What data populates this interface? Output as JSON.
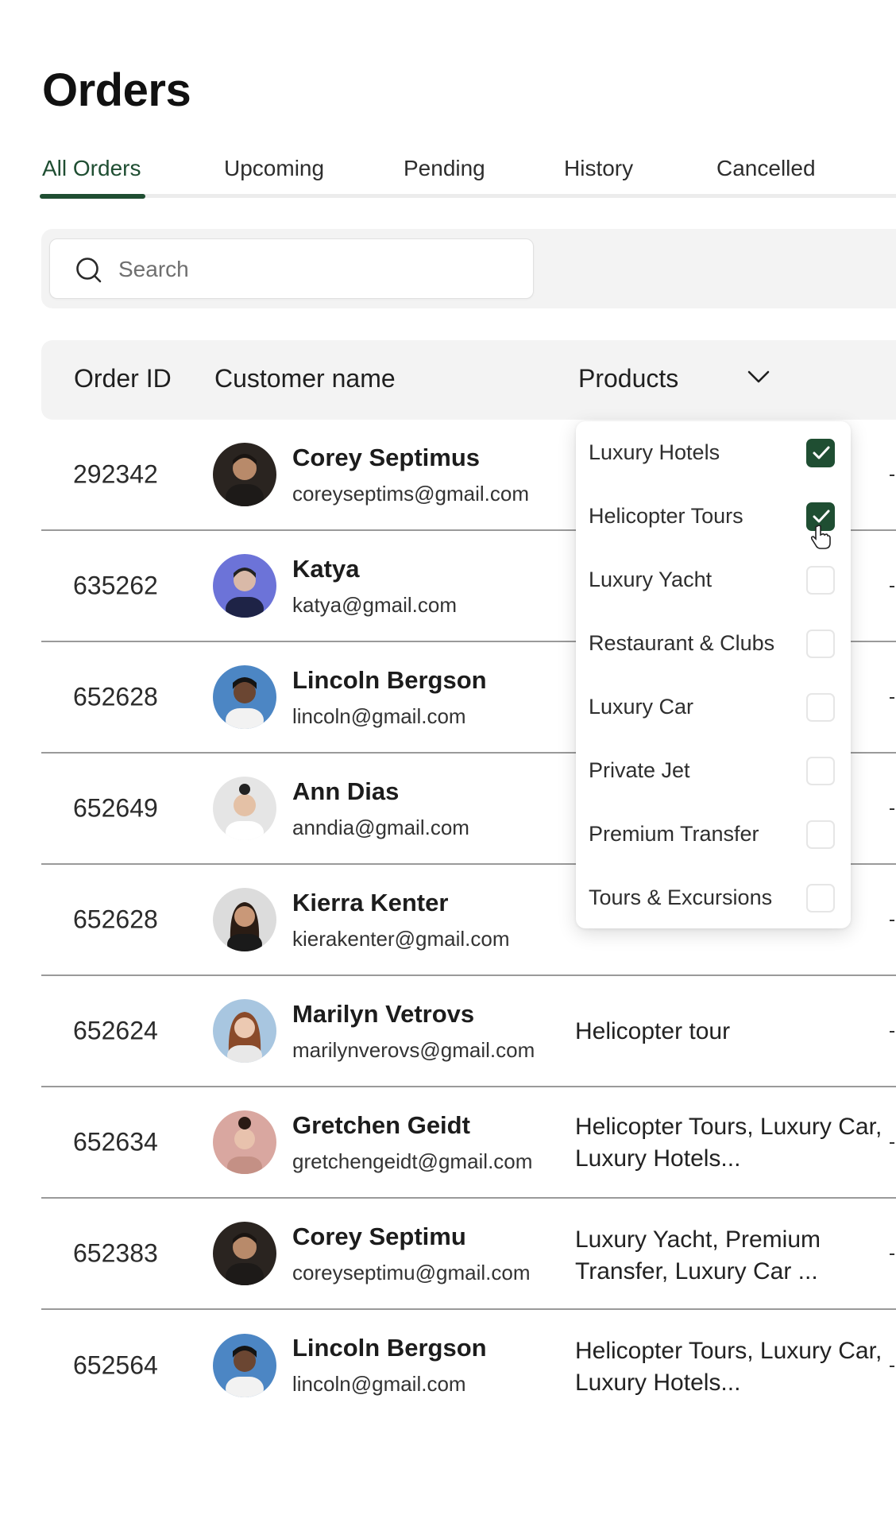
{
  "page": {
    "title": "Orders"
  },
  "tabs": [
    {
      "label": "All Orders",
      "active": true
    },
    {
      "label": "Upcoming"
    },
    {
      "label": "Pending"
    },
    {
      "label": "History"
    },
    {
      "label": "Cancelled"
    }
  ],
  "search": {
    "placeholder": "Search",
    "value": ""
  },
  "table": {
    "headers": {
      "order_id": "Order ID",
      "customer": "Customer name",
      "products": "Products"
    },
    "rows": [
      {
        "id": "292342",
        "name": "Corey Septimus",
        "email": "coreyseptims@gmail.com",
        "products": ""
      },
      {
        "id": "635262",
        "name": "Katya",
        "email": "katya@gmail.com",
        "products": ""
      },
      {
        "id": "652628",
        "name": "Lincoln Bergson",
        "email": "lincoln@gmail.com",
        "products": ""
      },
      {
        "id": "652649",
        "name": "Ann Dias",
        "email": "anndia@gmail.com",
        "products": ""
      },
      {
        "id": "652628",
        "name": "Kierra Kenter",
        "email": "kierakenter@gmail.com",
        "products": ""
      },
      {
        "id": "652624",
        "name": "Marilyn Vetrovs",
        "email": "marilynverovs@gmail.com",
        "products": "Helicopter tour"
      },
      {
        "id": "652634",
        "name": "Gretchen Geidt",
        "email": "gretchengeidt@gmail.com",
        "products": "Helicopter Tours, Luxury Car, Luxury Hotels..."
      },
      {
        "id": "652383",
        "name": "Corey Septimu",
        "email": "coreyseptimu@gmail.com",
        "products": "Luxury Yacht, Premium Transfer, Luxury Car ..."
      },
      {
        "id": "652564",
        "name": "Lincoln Bergson",
        "email": "lincoln@gmail.com",
        "products": "Helicopter Tours, Luxury Car, Luxury Hotels..."
      }
    ]
  },
  "products_dropdown": {
    "options": [
      {
        "label": "Luxury Hotels",
        "checked": true
      },
      {
        "label": "Helicopter Tours",
        "checked": true
      },
      {
        "label": "Luxury Yacht",
        "checked": false
      },
      {
        "label": "Restaurant & Clubs",
        "checked": false
      },
      {
        "label": "Luxury Car",
        "checked": false
      },
      {
        "label": "Private Jet",
        "checked": false
      },
      {
        "label": "Premium Transfer",
        "checked": false
      },
      {
        "label": "Tours & Excursions",
        "checked": false
      }
    ]
  },
  "colors": {
    "accent": "#1f4e32",
    "header_bg": "#f3f3f3",
    "divider": "#9a9a9a"
  },
  "icons": {
    "search": "search-icon",
    "products_toggle": "chevron-down-icon",
    "checkbox_check": "checkmark-icon",
    "pointer": "hand-cursor-icon"
  }
}
